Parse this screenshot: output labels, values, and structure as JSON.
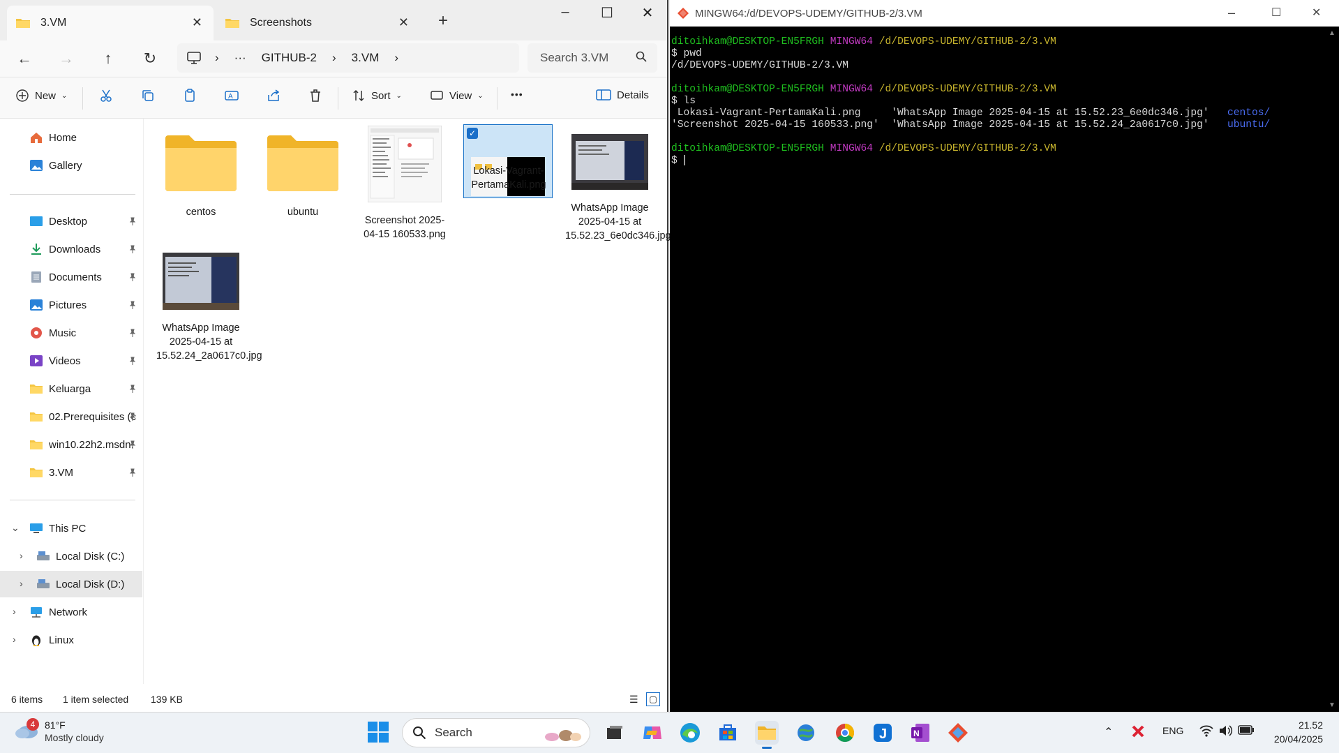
{
  "explorer": {
    "tabs": [
      {
        "label": "3.VM"
      },
      {
        "label": "Screenshots"
      }
    ],
    "breadcrumb": {
      "more": "···",
      "items": [
        "GITHUB-2",
        "3.VM"
      ]
    },
    "search_placeholder": "Search 3.VM",
    "toolbar": {
      "new": "New",
      "sort": "Sort",
      "view": "View",
      "more": "•••",
      "details": "Details"
    },
    "sidebar": {
      "home": "Home",
      "gallery": "Gallery",
      "quick": [
        "Desktop",
        "Downloads",
        "Documents",
        "Pictures",
        "Music",
        "Videos",
        "Keluarga",
        "02.Prerequisites (c",
        "win10.22h2.msdn.",
        "3.VM"
      ],
      "this_pc": "This PC",
      "disk_c": "Local Disk (C:)",
      "disk_d": "Local Disk (D:)",
      "network": "Network",
      "linux": "Linux"
    },
    "files": [
      {
        "name": "centos"
      },
      {
        "name": "ubuntu"
      },
      {
        "name": "Screenshot 2025-04-15 160533.png"
      },
      {
        "name": "Lokasi-Vagrant-PertamaKali.png"
      },
      {
        "name": "WhatsApp Image 2025-04-15 at 15.52.23_6e0dc346.jpg"
      },
      {
        "name": "WhatsApp Image 2025-04-15 at 15.52.24_2a0617c0.jpg"
      }
    ],
    "status": {
      "items": "6 items",
      "selected": "1 item selected",
      "size": "139 KB"
    }
  },
  "terminal": {
    "title": "MINGW64:/d/DEVOPS-UDEMY/GITHUB-2/3.VM",
    "prompt_user": "ditoihkam@DESKTOP-EN5FRGH",
    "prompt_env": "MINGW64",
    "prompt_path": "/d/DEVOPS-UDEMY/GITHUB-2/3.VM",
    "cmd1": "$ pwd",
    "out1": "/d/DEVOPS-UDEMY/GITHUB-2/3.VM",
    "cmd2": "$ ls",
    "ls_row1_a": " Lokasi-Vagrant-PertamaKali.png     'WhatsApp Image 2025-04-15 at 15.52.23_6e0dc346.jpg'   ",
    "ls_row1_b": "centos/",
    "ls_row2_a": "'Screenshot 2025-04-15 160533.png'  'WhatsApp Image 2025-04-15 at 15.52.24_2a0617c0.jpg'   ",
    "ls_row2_b": "ubuntu/",
    "cursor_line": "$ "
  },
  "taskbar": {
    "weather_badge": "4",
    "weather_temp": "81°F",
    "weather_desc": "Mostly cloudy",
    "search": "Search",
    "lang": "ENG",
    "time": "21.52",
    "date": "20/04/2025"
  }
}
